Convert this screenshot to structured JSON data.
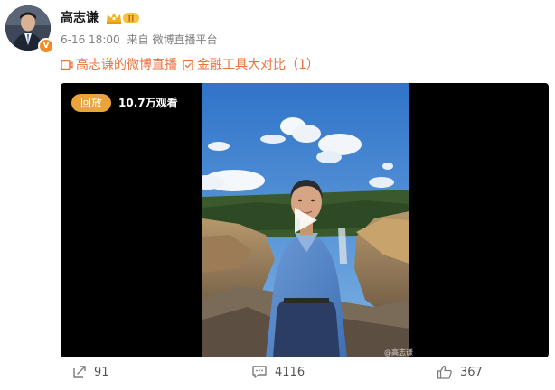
{
  "post": {
    "author": "高志谦",
    "verified_mark": "V",
    "member_level": "II",
    "date": "6-16 18:00",
    "source_prefix": "来自",
    "source": "微博直播平台"
  },
  "topics": [
    {
      "icon": "live-camera-icon",
      "label": "高志谦的微博直播"
    },
    {
      "icon": "checkbox-icon",
      "label": "金融工具大对比（1）"
    }
  ],
  "video": {
    "badge": "回放",
    "views": "10.7万观看",
    "watermark": "@高志谦"
  },
  "actions": {
    "repost_count": "91",
    "comment_count": "4116",
    "like_count": "367"
  },
  "colors": {
    "accent": "#eb7340",
    "badge": "#e9a43a",
    "verified": "#f38a24",
    "text_muted": "#808080"
  }
}
